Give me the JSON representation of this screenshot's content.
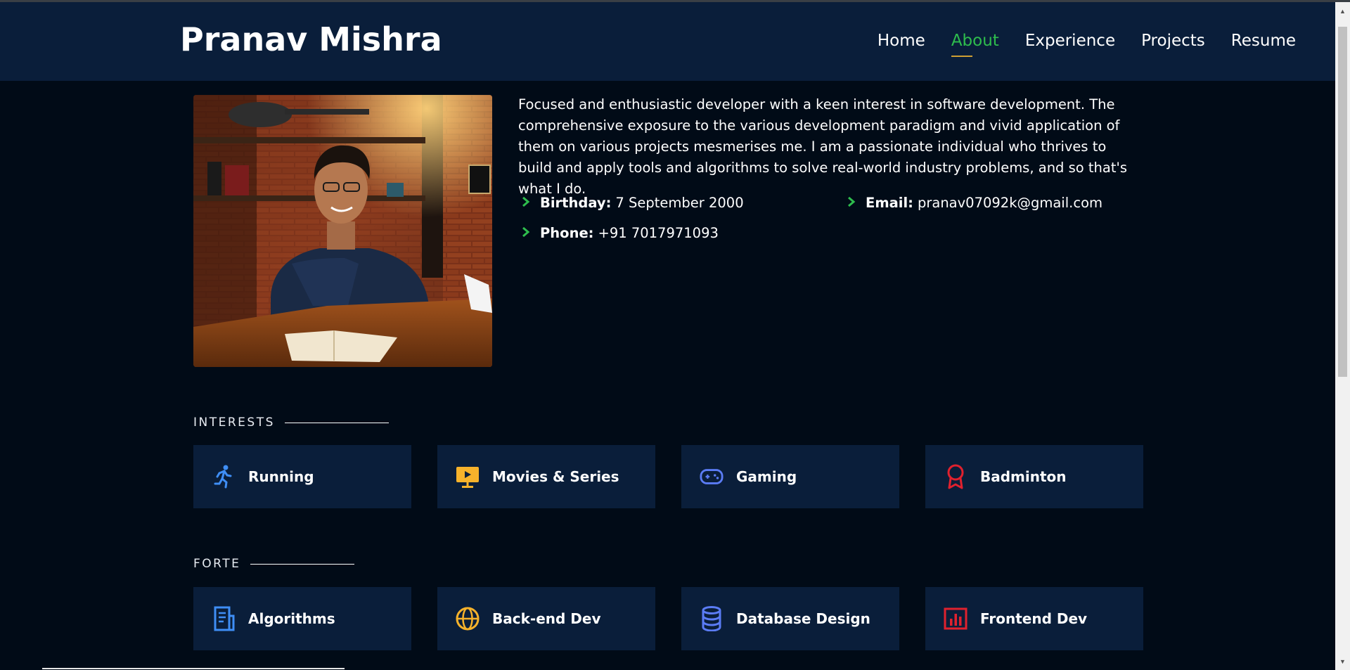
{
  "header": {
    "logo": "Pranav Mishra",
    "nav": [
      "Home",
      "About",
      "Experience",
      "Projects",
      "Resume"
    ],
    "active_nav": "About",
    "accent_color": "#2ebd4d"
  },
  "about": {
    "bio": "Focused and enthusiastic developer with a keen interest in software development. The comprehensive exposure to the various development paradigm and vivid application of them on various projects mesmerises me. I am a passionate individual who thrives to build and apply tools and algorithms to solve real-world industry problems, and so that's what I do.",
    "birthday_label": "Birthday:",
    "birthday_value": "7 September 2000",
    "email_label": "Email:",
    "email_value": "pranav07092k@gmail.com",
    "phone_label": "Phone:",
    "phone_value": "+91 7017971093"
  },
  "interests": {
    "title": "INTERESTS",
    "items": [
      {
        "label": "Running",
        "icon": "running-icon",
        "color": "#3f8ef5"
      },
      {
        "label": "Movies & Series",
        "icon": "movie-screen-icon",
        "color": "#f6b22b"
      },
      {
        "label": "Gaming",
        "icon": "gamepad-icon",
        "color": "#5b7cf5"
      },
      {
        "label": "Badminton",
        "icon": "award-ribbon-icon",
        "color": "#e0212e"
      }
    ]
  },
  "forte": {
    "title": "FORTE",
    "items": [
      {
        "label": "Algorithms",
        "icon": "document-list-icon",
        "color": "#3f8ef5"
      },
      {
        "label": "Back-end Dev",
        "icon": "globe-icon",
        "color": "#f6b22b"
      },
      {
        "label": "Database Design",
        "icon": "database-icon",
        "color": "#5b7cf5"
      },
      {
        "label": "Frontend Dev",
        "icon": "bar-chart-icon",
        "color": "#e0212e"
      }
    ]
  }
}
